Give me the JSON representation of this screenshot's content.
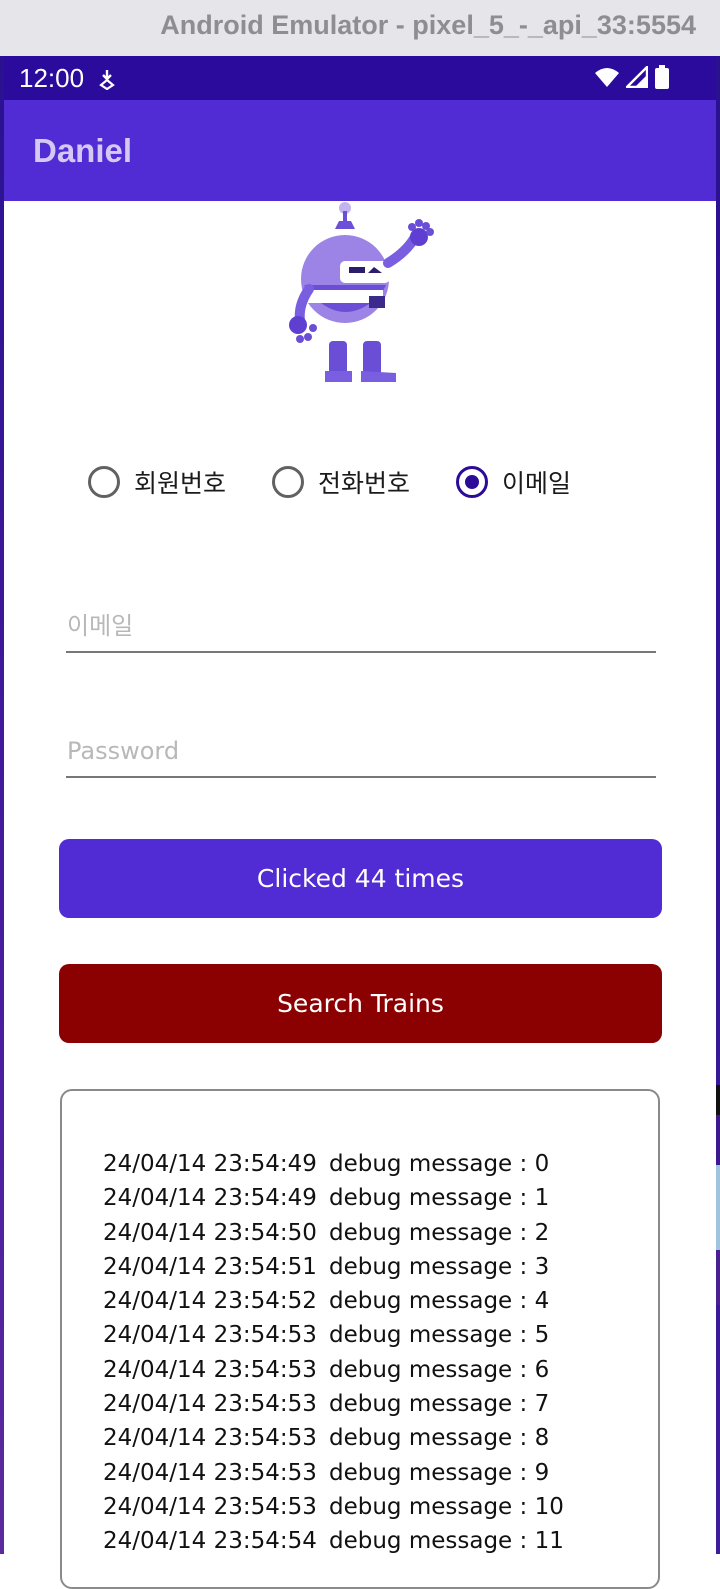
{
  "window": {
    "title": "Android Emulator - pixel_5_-_api_33:5554"
  },
  "status_bar": {
    "time": "12:00",
    "icons": [
      "notification-download-icon",
      "wifi-icon",
      "signal-icon",
      "battery-icon"
    ]
  },
  "app_bar": {
    "title": "Daniel"
  },
  "colors": {
    "primary": "#512bd4",
    "status_bar": "#2a0b9b",
    "danger": "#8b0000",
    "radio_checked": "#2b0b98"
  },
  "radio_options": [
    {
      "label": "회원번호",
      "checked": false
    },
    {
      "label": "전화번호",
      "checked": false
    },
    {
      "label": "이메일",
      "checked": true
    }
  ],
  "inputs": {
    "email": {
      "placeholder": "이메일",
      "value": ""
    },
    "password": {
      "placeholder": "Password",
      "value": ""
    }
  },
  "buttons": {
    "counter": "Clicked 44 times",
    "search": "Search Trains"
  },
  "log": [
    {
      "time": "24/04/14 23:54:49",
      "message": "debug message : 0"
    },
    {
      "time": "24/04/14 23:54:49",
      "message": "debug message : 1"
    },
    {
      "time": "24/04/14 23:54:50",
      "message": "debug message : 2"
    },
    {
      "time": "24/04/14 23:54:51",
      "message": "debug message : 3"
    },
    {
      "time": "24/04/14 23:54:52",
      "message": "debug message : 4"
    },
    {
      "time": "24/04/14 23:54:53",
      "message": "debug message : 5"
    },
    {
      "time": "24/04/14 23:54:53",
      "message": "debug message : 6"
    },
    {
      "time": "24/04/14 23:54:53",
      "message": "debug message : 7"
    },
    {
      "time": "24/04/14 23:54:53",
      "message": "debug message : 8"
    },
    {
      "time": "24/04/14 23:54:53",
      "message": "debug message : 9"
    },
    {
      "time": "24/04/14 23:54:53",
      "message": "debug message : 10"
    },
    {
      "time": "24/04/14 23:54:54",
      "message": "debug message : 11"
    }
  ]
}
